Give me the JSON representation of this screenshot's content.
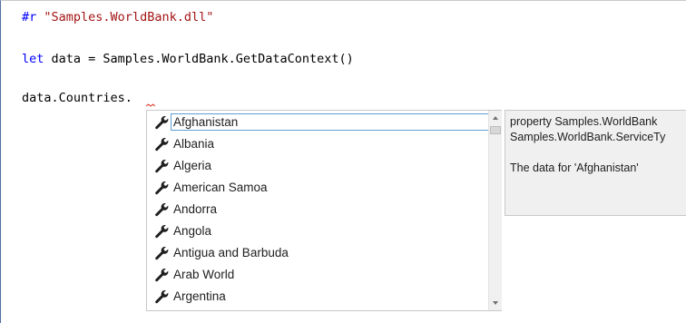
{
  "editor": {
    "line1": {
      "directive": "#r",
      "string": "\"Samples.WorldBank.dll\""
    },
    "line2": {
      "keyword": "let",
      "rest": " data = Samples.WorldBank.GetDataContext()"
    },
    "line3": {
      "text": "data.Countries."
    }
  },
  "completion": {
    "icon": "wrench-icon",
    "selected_index": 0,
    "items": [
      "Afghanistan",
      "Albania",
      "Algeria",
      "American Samoa",
      "Andorra",
      "Angola",
      "Antigua and Barbuda",
      "Arab World",
      "Argentina"
    ]
  },
  "tooltip": {
    "line1": "property Samples.WorldBank",
    "line2": "Samples.WorldBank.ServiceTy",
    "line3": "The data for 'Afghanistan'"
  },
  "colors": {
    "keyword": "#0000ff",
    "string": "#a31515",
    "selection_border": "#5e9ccf",
    "squiggle": "#e0301e"
  }
}
